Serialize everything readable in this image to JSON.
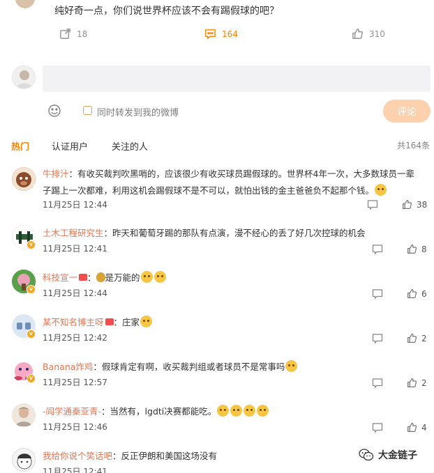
{
  "post": {
    "text": "纯好奇一点，你们说世界杯应该不会有踢假球的吧？"
  },
  "actions": {
    "repost_count": "18",
    "comment_count": "164",
    "like_count": "310"
  },
  "compose": {
    "placeholder": "",
    "repost_label": "同时转发到我的微博",
    "submit_label": "评论"
  },
  "tabs": [
    {
      "label": "热门"
    },
    {
      "label": "认证用户"
    },
    {
      "label": "关注的人"
    }
  ],
  "total": "共164条",
  "comments": [
    {
      "user": "牛排汁",
      "sep": "：",
      "text": "有收买裁判吹黑哨的，应该很少有收买球员踢假球的。世界杯4年一次，大多数球员一辈子踢上一次都难，利用这机会踢假球不是不可以，就怕出钱的金主爸爸负不起那个钱。",
      "time": "11月25日 12:44",
      "likes": "38"
    },
    {
      "user": "土木工程研究生",
      "sep": "：",
      "text": "昨天和葡萄牙踢的那队有点演，漫不经心的丢了好几次控球的机会",
      "time": "11月25日 12:41",
      "likes": "8"
    },
    {
      "user": "科技宣一",
      "sep": "：",
      "text": "是万能的",
      "time": "11月25日 12:44",
      "likes": "6"
    },
    {
      "user": "某不知名博主呀",
      "sep": "：",
      "text": "庄家",
      "time": "11月25日 12:42",
      "likes": "2"
    },
    {
      "user": "Banana炸鸡",
      "sep": "：",
      "text": "假球肯定有啊，收买裁判组或者球员不是常事吗",
      "time": "11月25日 12:57",
      "likes": "2"
    },
    {
      "user": "-阎学通秦亚青-",
      "sep": "：",
      "text": "当然有，lgdti决赛都能吃。",
      "time": "11月25日 12:46",
      "likes": "4"
    },
    {
      "user": "我给你说个笑话吧",
      "sep": "：",
      "text": "反正伊朗和美国这场没有",
      "time": "11月25日 12:41",
      "likes": ""
    }
  ],
  "watermark": "大金链子",
  "icons": [
    "repost-icon",
    "comment-icon",
    "like-icon",
    "emoji-icon",
    "reply-icon",
    "verified-badge-icon",
    "wechat-icon"
  ],
  "colors": {
    "accent": "#ff8200",
    "username": "#eb7350",
    "submit_bg": "#fdd0ae",
    "input_bg": "#f2f2f5"
  }
}
